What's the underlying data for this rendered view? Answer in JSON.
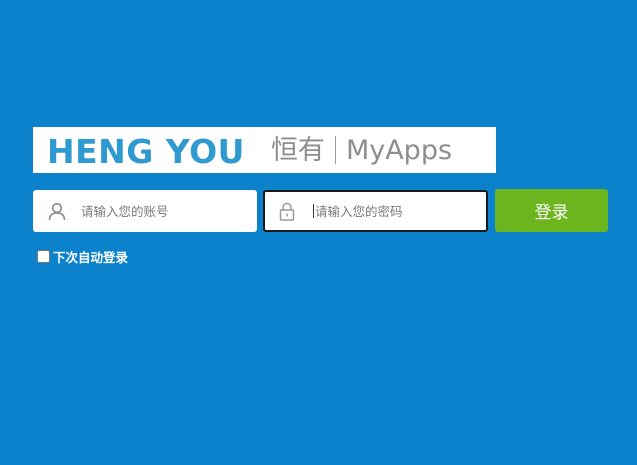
{
  "logo": {
    "brand_en": "HENG YOU",
    "brand_cn": "恒有",
    "app_name": "MyApps"
  },
  "login": {
    "username_placeholder": "请输入您的账号",
    "password_placeholder": "请输入您的密码",
    "submit_label": "登录",
    "remember_label": "下次自动登录",
    "remember_checked": false
  },
  "icons": {
    "username": "user-icon",
    "password": "lock-icon"
  },
  "colors": {
    "background": "#0b82cb",
    "brand_blue": "#2f9ad0",
    "brand_gray": "#8e8e8e",
    "button_green": "#6db51f"
  }
}
